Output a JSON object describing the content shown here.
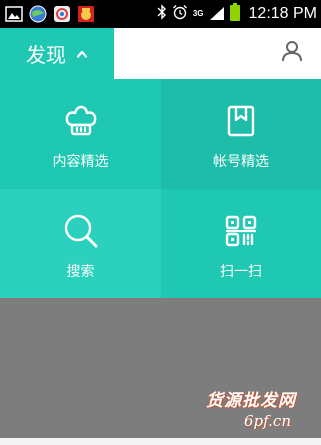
{
  "status_bar": {
    "time": "12:18 PM",
    "network": "3G",
    "left_icons": [
      "gallery-icon",
      "browser-icon",
      "app-icon",
      "notification-app-icon"
    ],
    "right_icons": [
      "bluetooth-icon",
      "alarm-icon",
      "signal-icon",
      "battery-icon"
    ]
  },
  "header": {
    "title": "发现",
    "caret_icon": "chevron-up-icon",
    "user_icon": "user-icon"
  },
  "menu": {
    "items": [
      {
        "label": "内容精选",
        "icon": "chef-hat-icon"
      },
      {
        "label": "帐号精选",
        "icon": "bookmark-book-icon"
      },
      {
        "label": "搜索",
        "icon": "search-icon"
      },
      {
        "label": "扫一扫",
        "icon": "qr-code-icon"
      }
    ]
  },
  "watermark": {
    "line1": "货源批发网",
    "line2": "6pf.cn"
  },
  "colors": {
    "teal": "#1ec8b2",
    "teal_dark": "#1dbda9",
    "teal_light": "#2bd1bd",
    "overlay": "#7d7d7d"
  }
}
